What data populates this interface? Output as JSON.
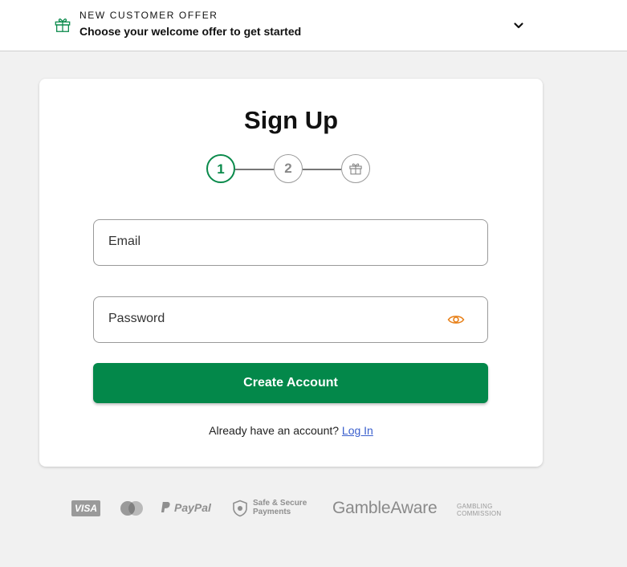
{
  "offer": {
    "kicker": "NEW CUSTOMER OFFER",
    "headline": "Choose your welcome offer to get started",
    "icon": "gift-icon",
    "toggle_icon": "chevron-down-icon"
  },
  "signup": {
    "title": "Sign Up",
    "steps": [
      "1",
      "2"
    ],
    "final_step_icon": "gift-icon",
    "email": {
      "label": "Email"
    },
    "password": {
      "label": "Password",
      "toggle_icon": "eye-icon"
    },
    "cta_label": "Create Account",
    "login_prompt": "Already have an account?",
    "login_link": "Log In"
  },
  "footer": {
    "visa": "VISA",
    "mastercard_icon": "mastercard-icon",
    "paypal": "PayPal",
    "safe_payments": [
      "Safe & Secure",
      "Payments"
    ],
    "gambleaware": "GambleAware",
    "commission": [
      "GAMBLING",
      "COMMISSION"
    ]
  },
  "colors": {
    "primary_green": "#03884a",
    "active_step": "#0a8a4b",
    "eye_icon": "#e8811a",
    "link": "#3a5fcd",
    "page_background": "#f1f1f1"
  }
}
